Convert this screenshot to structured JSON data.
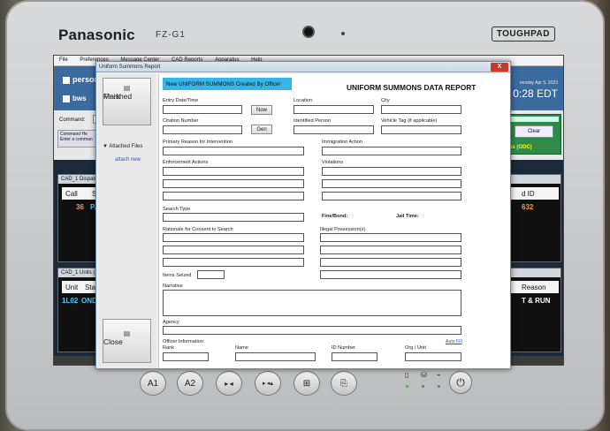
{
  "device": {
    "brand": "Panasonic",
    "model": "FZ-G1",
    "badge": "TOUGHPAD",
    "buttons": [
      "A1",
      "A2",
      "▸ ◂",
      "▸ ◂▴",
      "⊞",
      "⎘",
      "⏻"
    ]
  },
  "app": {
    "menu": [
      "File",
      "Preferences",
      "Message Center",
      "CAD Reports",
      "Apparatus",
      "Help"
    ],
    "toolbar": {
      "item1": "persons",
      "item2": "bws"
    },
    "date": "nesday Apr 5, 2023",
    "time": "0:28 EDT",
    "command_label": "Command:",
    "command_help_title": "Command He",
    "command_help_sub": "Enter a comman",
    "clear_label": "Clear",
    "odc_label": "ss (ODC)",
    "dispatch_panel": {
      "title": "CAD_1 Dispatche",
      "headers": [
        "Call",
        "Sta",
        "d ID"
      ],
      "row": [
        "36",
        "PAG",
        "632"
      ]
    },
    "units_panel": {
      "title": "CAD_1 Units (1)",
      "headers": [
        "Unit",
        "Stat",
        "Reason"
      ],
      "row": [
        "1L02",
        "ONDT",
        "T & RUN"
      ]
    }
  },
  "dialog": {
    "window_title": "Uniform Summons Report",
    "close_x": "X",
    "mark_finished": [
      "Mark",
      "Finished"
    ],
    "attached_files": "Attached Files",
    "attach_new": "attach new",
    "close_label": "Close",
    "banner": "New UNIFORM SUMMONS Created By Officer",
    "report_title": "UNIFORM SUMMONS DATA REPORT",
    "labels": {
      "entry_datetime": "Entry Date/Time",
      "location": "Location",
      "city": "City",
      "citation_number": "Citation Number",
      "identified_person": "Identified Person",
      "vehicle_tag": "Vehicle Tag (if applicable)",
      "primary_reason": "Primary Reason for Intervention",
      "immigration_action": "Immigration Action",
      "enforcement_actions": "Enforcement Actions",
      "violations": "Violations",
      "search_type": "Search Type",
      "fine_bond": "Fine/Bond:",
      "jail_time": "Jail Time:",
      "rationale": "Rationale for Consent to Search",
      "illegal_possession": "Illegal Possession(s)",
      "items_seized": "Items Seized",
      "narrative": "Narrative",
      "agency": "Agency",
      "officer_information": "Officer Information",
      "auto_fill": "Auto Fill",
      "rank": "Rank",
      "name": "Name",
      "id_number": "ID Number",
      "org_unit": "Org / Unit"
    },
    "buttons": {
      "now": "Now",
      "gen": "Gen"
    }
  }
}
